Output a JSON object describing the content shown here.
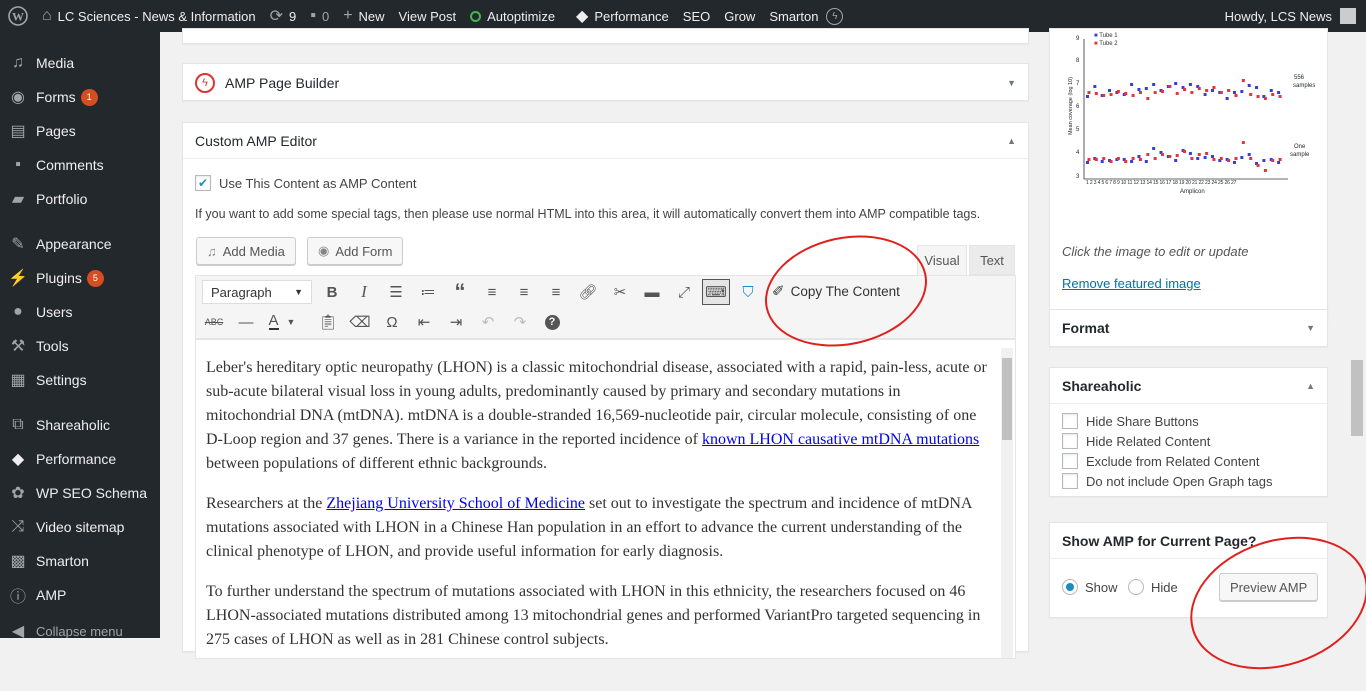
{
  "adminbar": {
    "site_name": "LC Sciences - News & Information",
    "updates_count": "9",
    "comments_count": "0",
    "new_label": "New",
    "view_post_label": "View Post",
    "autoptimize_label": "Autoptimize",
    "performance_label": "Performance",
    "seo_label": "SEO",
    "grow_label": "Grow",
    "smarton_label": "Smarton",
    "howdy_label": "Howdy, LCS News"
  },
  "sidebar": {
    "items": [
      {
        "label": "Media"
      },
      {
        "label": "Forms",
        "badge": "1"
      },
      {
        "label": "Pages"
      },
      {
        "label": "Comments"
      },
      {
        "label": "Portfolio"
      },
      {
        "label": "Appearance"
      },
      {
        "label": "Plugins",
        "badge": "5"
      },
      {
        "label": "Users"
      },
      {
        "label": "Tools"
      },
      {
        "label": "Settings"
      },
      {
        "label": "Shareaholic"
      },
      {
        "label": "Performance"
      },
      {
        "label": "WP SEO Schema"
      },
      {
        "label": "Video sitemap"
      },
      {
        "label": "Smarton"
      },
      {
        "label": "AMP"
      }
    ],
    "collapse_label": "Collapse menu"
  },
  "amp_builder": {
    "title": "AMP Page Builder"
  },
  "custom_amp": {
    "title": "Custom AMP Editor",
    "use_content_label": "Use This Content as AMP Content",
    "use_content_checked": true,
    "help_text": "If you want to add some special tags, then please use normal HTML into this area, it will automatically convert them into AMP compatible tags.",
    "add_media_label": "Add Media",
    "add_form_label": "Add Form",
    "tab_visual": "Visual",
    "tab_text": "Text",
    "format_select": "Paragraph",
    "copy_content_label": "Copy The Content",
    "para1_a": "Leber's hereditary optic neuropathy (LHON) is a classic mitochondrial disease, associated with a rapid, pain-less, acute or sub-acute bilateral visual loss in young adults, predominantly caused by primary and secondary mutations in mitochondrial DNA (mtDNA). mtDNA is a double-stranded 16,569-nucleotide pair, circular molecule, consisting of one D-Loop region and 37 genes. There is a variance in the reported incidence of ",
    "para1_link": "known LHON causative mtDNA mutations",
    "para1_b": " between populations of different ethnic backgrounds.",
    "para2_a": "Researchers at the ",
    "para2_link": "Zhejiang University School of Medicine",
    "para2_b": " set out to investigate the spectrum and incidence of mtDNA mutations associated with LHON in a Chinese Han population in an effort to advance the current understanding of the clinical phenotype of LHON, and provide useful information for early diagnosis.",
    "para3": "To further understand the spectrum of mutations associated with LHON in this ethnicity, the researchers focused on 46 LHON-associated mutations distributed among 13 mitochondrial genes and performed VariantPro targeted sequencing in 275 cases of LHON as well as in 281 Chinese control subjects."
  },
  "featured": {
    "legend_1": "Tube 1",
    "legend_2": "Tube 2",
    "y_label": "Mean coverage (log 10)",
    "x_label": "Amplicon",
    "annot_top_1": "556",
    "annot_top_2": "samples",
    "annot_bot_1": "One",
    "annot_bot_2": "sample",
    "y_ticks": [
      "9",
      "8",
      "7",
      "6",
      "5",
      "4",
      "3"
    ],
    "x_ticks": "1 2 3 4 5 6 7 8 9 10 11 12 13 14 15 16 17 18 19 20 21 22 23 24 25 26 27",
    "hint": "Click the image to edit or update",
    "remove_label": "Remove featured image"
  },
  "format_box": {
    "title": "Format"
  },
  "shareaholic": {
    "title": "Shareaholic",
    "options": [
      "Hide Share Buttons",
      "Hide Related Content",
      "Exclude from Related Content",
      "Do not include Open Graph tags"
    ]
  },
  "show_amp": {
    "title": "Show AMP for Current Page?",
    "show_label": "Show",
    "hide_label": "Hide",
    "selected": "Show",
    "preview_label": "Preview AMP"
  },
  "colors": {
    "admin_bg": "#23282d",
    "accent": "#0073aa",
    "annotation": "#e0201f",
    "tube1": "#3b3bd9",
    "tube2": "#e8323c"
  }
}
